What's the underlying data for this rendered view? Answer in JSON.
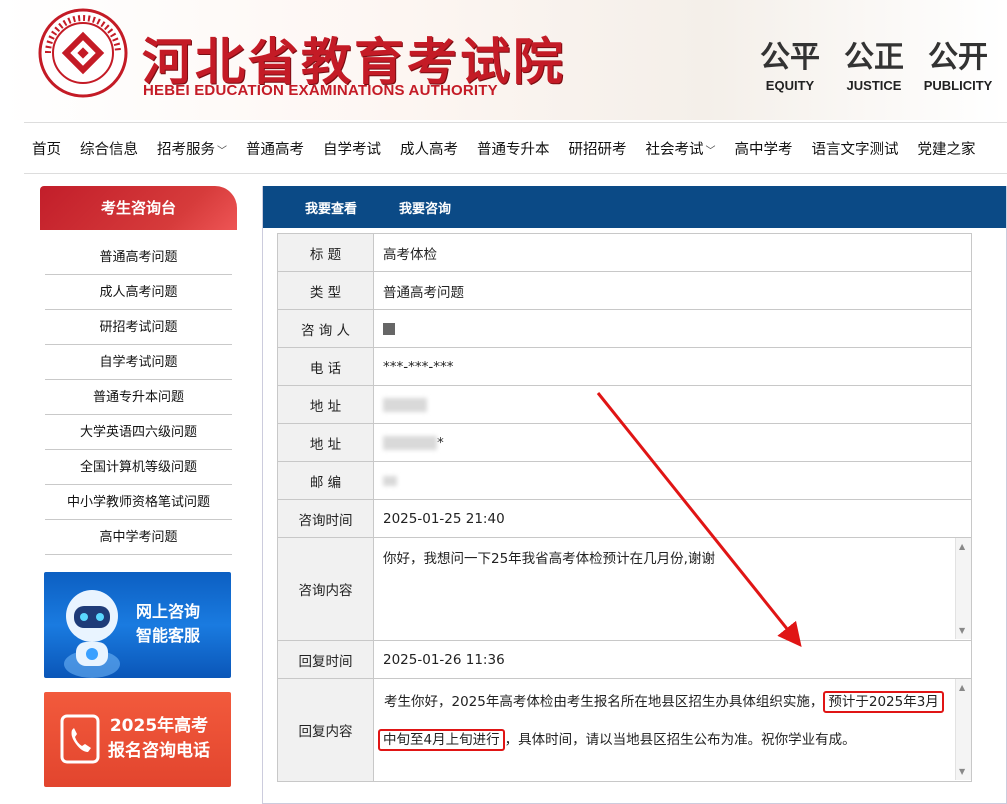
{
  "header": {
    "title_cn": "河北省教育考试院",
    "title_en": "HEBEI EDUCATION EXAMINATIONS AUTHORITY",
    "mottos": [
      {
        "cn": "公平",
        "en": "EQUITY"
      },
      {
        "cn": "公正",
        "en": "JUSTICE"
      },
      {
        "cn": "公开",
        "en": "PUBLICITY"
      }
    ]
  },
  "nav": {
    "items": [
      "首页",
      "综合信息",
      "招考服务",
      "普通高考",
      "自学考试",
      "成人高考",
      "普通专升本",
      "研招研考",
      "社会考试",
      "高中学考",
      "语言文字测试",
      "党建之家"
    ]
  },
  "sidebar": {
    "title": "考生咨询台",
    "items": [
      "普通高考问题",
      "成人高考问题",
      "研招考试问题",
      "自学考试问题",
      "普通专升本问题",
      "大学英语四六级问题",
      "全国计算机等级问题",
      "中小学教师资格笔试问题",
      "高中学考问题"
    ],
    "banner1": {
      "line1": "网上咨询",
      "line2": "智能客服"
    },
    "banner2": {
      "line1": "2025年高考",
      "line2": "报名咨询电话"
    }
  },
  "tabs": [
    "我要查看",
    "我要咨询"
  ],
  "detail": {
    "labels": {
      "title": "标 题",
      "type": "类 型",
      "asker": "咨 询 人",
      "phone": "电 话",
      "address1": "地 址",
      "address2": "地 址",
      "postcode": "邮 编",
      "ask_time": "咨询时间",
      "ask_content": "咨询内容",
      "reply_time": "回复时间",
      "reply_content": "回复内容"
    },
    "values": {
      "title": "高考体检",
      "type": "普通高考问题",
      "phone": "***-***-***",
      "address2_suffix": "*",
      "ask_time": "2025-01-25 21:40",
      "ask_content": "你好，我想问一下25年我省高考体检预计在几月份,谢谢",
      "reply_time": "2025-01-26 11:36",
      "reply_part1": "考生你好，2025年高考体检由考生报名所在地县区招生办具体组织实施，",
      "reply_highlight1": "预计于2025年3月",
      "reply_highlight2": "中旬至4月上旬进行",
      "reply_part2": "，具体时间，请以当地县区招生公布为准。祝你学业有成。"
    }
  },
  "colors": {
    "brand_red": "#c41b26",
    "tab_bar_blue": "#0b4a86",
    "highlight_red": "#e01515"
  }
}
